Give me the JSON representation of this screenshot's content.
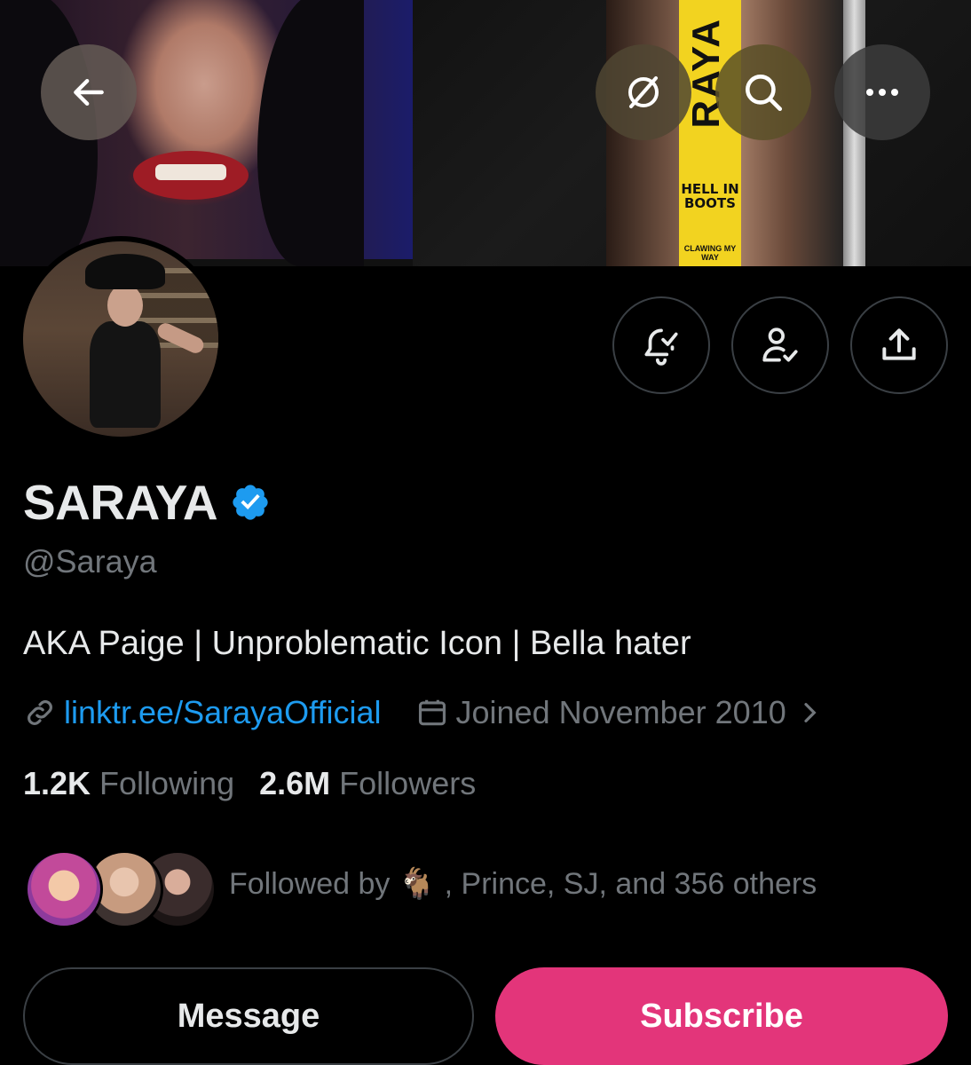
{
  "banner": {
    "book_spine_text": "RAYA",
    "book_title": "HELL IN BOOTS",
    "book_subtitle": "CLAWING MY WAY"
  },
  "header_icons": {
    "back": "arrow-left-icon",
    "grok": "grok-icon",
    "search": "search-icon",
    "more": "more-icon"
  },
  "actions": {
    "notify_icon": "bell-check-icon",
    "follow_icon": "user-check-icon",
    "share_icon": "share-icon"
  },
  "profile": {
    "display_name": "SARAYA",
    "verified_icon": "verified-badge-icon",
    "verified_color": "#1d9bf0",
    "handle": "@Saraya",
    "bio": "AKA Paige | Unproblematic Icon | Bella hater",
    "link": "linktr.ee/SarayaOfficial",
    "joined": "Joined November 2010",
    "following_count": "1.2K",
    "following_label": "Following",
    "followers_count": "2.6M",
    "followers_label": "Followers",
    "followed_by": "Followed by 🐐 , Prince, SJ, and 356 others"
  },
  "buttons": {
    "message": "Message",
    "subscribe": "Subscribe",
    "subscribe_color": "#e3357a"
  }
}
